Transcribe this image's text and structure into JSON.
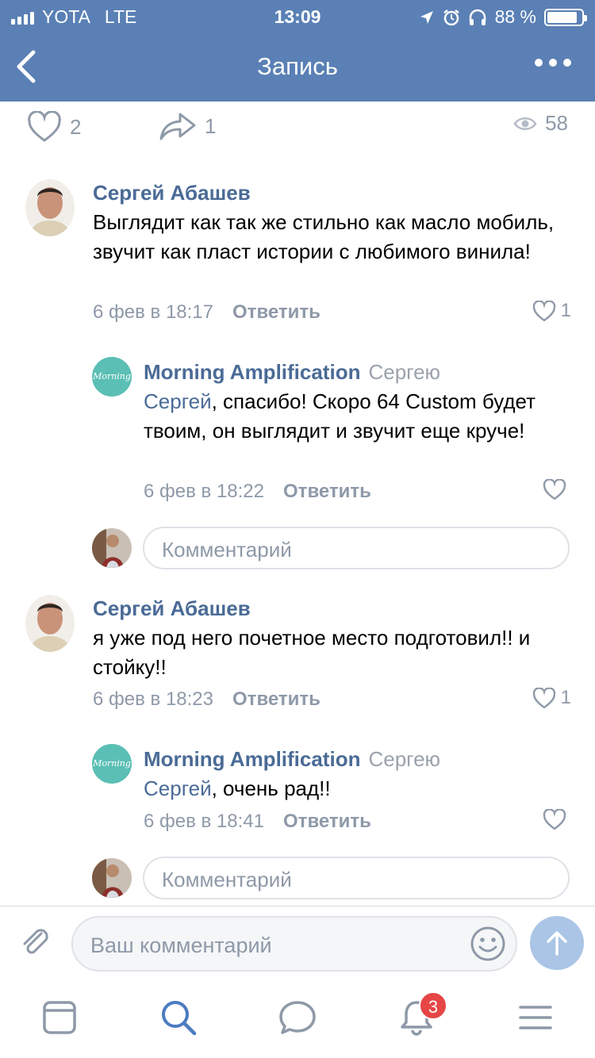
{
  "status_bar": {
    "carrier": "YOTA",
    "network": "LTE",
    "time": "13:09",
    "battery": "88 %",
    "battery_level": 0.88
  },
  "navbar": {
    "title": "Запись",
    "back_icon": "chevron-left-icon",
    "more_icon": "more-dots-icon"
  },
  "stats": {
    "likes": "2",
    "shares": "1",
    "views": "58"
  },
  "comments": [
    {
      "author": "Сергей Абашев",
      "to": "",
      "mention": "",
      "text": "Выглядит как так же стильно как масло мобиль, звучит как пласт истории с любимого винила!",
      "date": "6 фев в 18:17",
      "reply_label": "Ответить",
      "likes": "1"
    },
    {
      "author": "Morning Amplification",
      "to": "Сергею",
      "mention": "Сергей",
      "text": ", спасибо! Скоро 64 Custom будет твоим, он выглядит и звучит еще круче!",
      "date": "6 фев в 18:22",
      "reply_label": "Ответить",
      "likes": "",
      "avatar_text": "Morning"
    },
    {
      "author": "Сергей Абашев",
      "to": "",
      "mention": "",
      "text": "я уже под него почетное место подготовил!! и стойку!!",
      "date": "6 фев в 18:23",
      "reply_label": "Ответить",
      "likes": "1"
    },
    {
      "author": "Morning Amplification",
      "to": "Сергею",
      "mention": "Сергей",
      "text": ", очень рад!!",
      "date": "6 фев в 18:41",
      "reply_label": "Ответить",
      "likes": "",
      "avatar_text": "Morning"
    }
  ],
  "reply_placeholder": "Комментарий",
  "input": {
    "placeholder": "Ваш комментарий"
  },
  "tabbar": {
    "notifications_badge": "3"
  },
  "colors": {
    "header": "#5a80b5",
    "link": "#4a6b96",
    "muted": "#8e99a8",
    "badge": "#e64646",
    "teal": "#5bbfb5"
  }
}
